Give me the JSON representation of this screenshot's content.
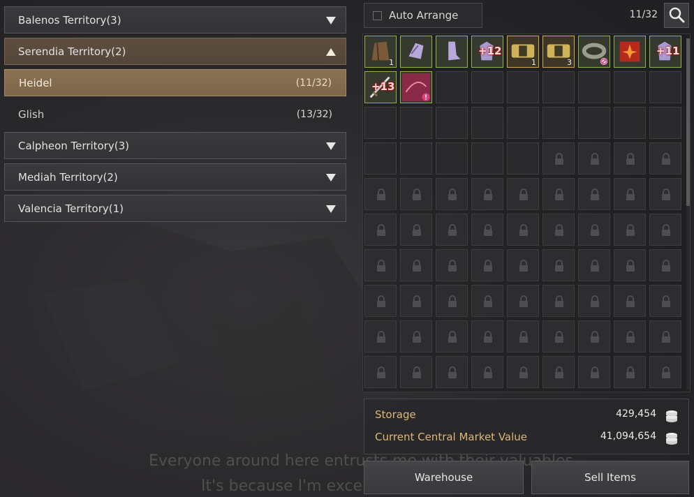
{
  "territories": [
    {
      "label": "Balenos Territory(3)",
      "expanded": false
    },
    {
      "label": "Serendia Territory(2)",
      "expanded": true,
      "towns": [
        {
          "name": "Heidel",
          "count": "(11/32)",
          "selected": true
        },
        {
          "name": "Glish",
          "count": "(13/32)",
          "selected": false
        }
      ]
    },
    {
      "label": "Calpheon Territory(3)",
      "expanded": false
    },
    {
      "label": "Mediah Territory(2)",
      "expanded": false
    },
    {
      "label": "Valencia Territory(1)",
      "expanded": false
    }
  ],
  "toolbar": {
    "auto_arrange_label": "Auto Arrange",
    "auto_arrange_checked": false,
    "capacity": "11/32",
    "search_icon": "search-icon"
  },
  "storage_items": [
    {
      "icon": "backpack-icon",
      "grade": "green",
      "qty": "1"
    },
    {
      "icon": "gauntlet-icon",
      "grade": "green",
      "qty": ""
    },
    {
      "icon": "boots-icon",
      "grade": "green",
      "qty": ""
    },
    {
      "icon": "armor-icon",
      "grade": "green",
      "enhance": "+12"
    },
    {
      "icon": "gold-ingot-icon",
      "grade": "gold",
      "qty": "1"
    },
    {
      "icon": "gold-ingot-icon",
      "grade": "gold",
      "qty": "3"
    },
    {
      "icon": "bracelet-icon",
      "grade": "green",
      "badge": "no-trade"
    },
    {
      "icon": "red-book-icon",
      "grade": "green",
      "qty": ""
    },
    {
      "icon": "armor-icon",
      "grade": "green",
      "enhance": "+11"
    },
    {
      "icon": "sword-icon",
      "grade": "green",
      "enhance": "+13"
    },
    {
      "icon": "crossbow-icon",
      "grade": "green",
      "badge": "alert"
    }
  ],
  "grid": {
    "columns": 9,
    "rows": 10,
    "empty_slots": 21,
    "expand_slot_index": 32
  },
  "summary": {
    "storage_label": "Storage",
    "storage_value": "429,454",
    "market_label": "Current Central Market Value",
    "market_value": "41,094,654"
  },
  "buttons": {
    "warehouse": "Warehouse",
    "sell_items": "Sell Items"
  },
  "npc_dialogue": {
    "line1": "Everyone around here entrusts me with their valuables",
    "line2": "It's because I'm exce"
  },
  "colors": {
    "accent_gold": "#e0b770",
    "selected_bg": "#8a7153",
    "item_border_green": "#8fb54a",
    "item_border_gold": "#d2a94a"
  }
}
